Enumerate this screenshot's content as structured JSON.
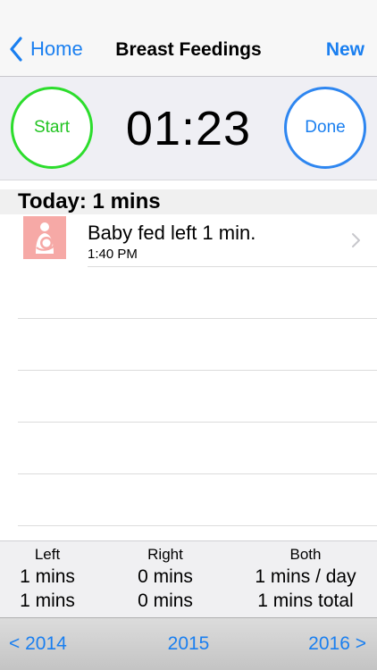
{
  "nav": {
    "back_label": "Home",
    "title": "Breast Feedings",
    "new_label": "New"
  },
  "timer": {
    "start_label": "Start",
    "done_label": "Done",
    "display": "01:23"
  },
  "section": {
    "header": "Today: 1 mins"
  },
  "entries": [
    {
      "title": "Baby fed left 1 min.",
      "time": "1:40 PM",
      "icon": "breastfeeding-icon"
    }
  ],
  "stats": {
    "left": {
      "header": "Left",
      "per_day": "1 mins",
      "total": "1 mins"
    },
    "right": {
      "header": "Right",
      "per_day": "0 mins",
      "total": "0 mins"
    },
    "both": {
      "header": "Both",
      "per_day": "1 mins / day",
      "total": "1 mins total"
    }
  },
  "years": {
    "prev": "< 2014",
    "current": "2015",
    "next": "2016 >"
  },
  "colors": {
    "accent": "#1a7ff0",
    "start": "#2cdd2c",
    "icon_bg": "#f6a9a6"
  }
}
